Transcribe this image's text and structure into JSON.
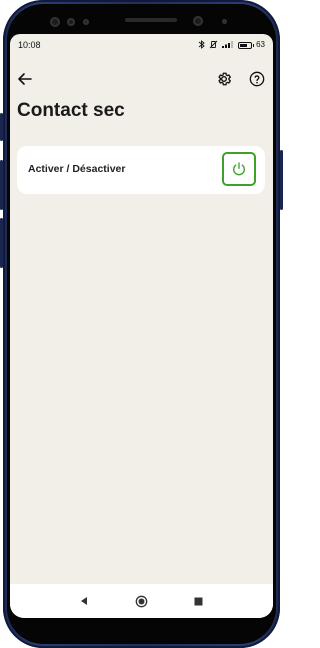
{
  "status_bar": {
    "time": "10:08",
    "battery_percent": "63",
    "icons": [
      "bluetooth-icon",
      "vibrate-off-icon",
      "signal-icon",
      "battery-icon"
    ]
  },
  "app_bar": {
    "back_icon": "arrow-left-icon",
    "settings_icon": "gear-icon",
    "help_icon": "help-circle-icon"
  },
  "page": {
    "title": "Contact sec"
  },
  "toggle_card": {
    "label": "Activer / Désactiver",
    "button_icon": "power-icon",
    "accent_color": "#3ea12b"
  },
  "nav_bar": {
    "icons": [
      "nav-back-icon",
      "nav-home-icon",
      "nav-recent-icon"
    ]
  },
  "colors": {
    "background": "#f1efe8",
    "card": "#ffffff",
    "phone_frame": "#1f2f5e"
  }
}
